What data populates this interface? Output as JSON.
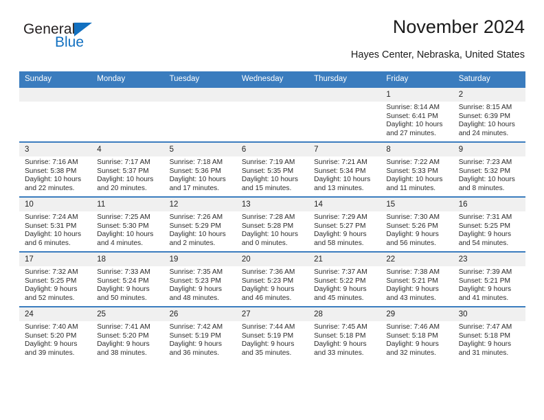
{
  "logo": {
    "word_top": "General",
    "word_bottom": "Blue",
    "triangle_icon": "triangle-icon",
    "brand_color": "#1270c0"
  },
  "header": {
    "title": "November 2024",
    "subtitle": "Hayes Center, Nebraska, United States"
  },
  "theme": {
    "header_blue": "#3a7cbe",
    "daynum_gray": "#f0f0f0"
  },
  "calendar": {
    "weekday_headers": [
      "Sunday",
      "Monday",
      "Tuesday",
      "Wednesday",
      "Thursday",
      "Friday",
      "Saturday"
    ],
    "labels": {
      "sunrise": "Sunrise:",
      "sunset": "Sunset:",
      "daylight": "Daylight:"
    },
    "weeks": [
      [
        {
          "day": "",
          "empty": true
        },
        {
          "day": "",
          "empty": true
        },
        {
          "day": "",
          "empty": true
        },
        {
          "day": "",
          "empty": true
        },
        {
          "day": "",
          "empty": true
        },
        {
          "day": "1",
          "sunrise": "Sunrise: 8:14 AM",
          "sunset": "Sunset: 6:41 PM",
          "daylight": "Daylight: 10 hours and 27 minutes."
        },
        {
          "day": "2",
          "sunrise": "Sunrise: 8:15 AM",
          "sunset": "Sunset: 6:39 PM",
          "daylight": "Daylight: 10 hours and 24 minutes."
        }
      ],
      [
        {
          "day": "3",
          "sunrise": "Sunrise: 7:16 AM",
          "sunset": "Sunset: 5:38 PM",
          "daylight": "Daylight: 10 hours and 22 minutes."
        },
        {
          "day": "4",
          "sunrise": "Sunrise: 7:17 AM",
          "sunset": "Sunset: 5:37 PM",
          "daylight": "Daylight: 10 hours and 20 minutes."
        },
        {
          "day": "5",
          "sunrise": "Sunrise: 7:18 AM",
          "sunset": "Sunset: 5:36 PM",
          "daylight": "Daylight: 10 hours and 17 minutes."
        },
        {
          "day": "6",
          "sunrise": "Sunrise: 7:19 AM",
          "sunset": "Sunset: 5:35 PM",
          "daylight": "Daylight: 10 hours and 15 minutes."
        },
        {
          "day": "7",
          "sunrise": "Sunrise: 7:21 AM",
          "sunset": "Sunset: 5:34 PM",
          "daylight": "Daylight: 10 hours and 13 minutes."
        },
        {
          "day": "8",
          "sunrise": "Sunrise: 7:22 AM",
          "sunset": "Sunset: 5:33 PM",
          "daylight": "Daylight: 10 hours and 11 minutes."
        },
        {
          "day": "9",
          "sunrise": "Sunrise: 7:23 AM",
          "sunset": "Sunset: 5:32 PM",
          "daylight": "Daylight: 10 hours and 8 minutes."
        }
      ],
      [
        {
          "day": "10",
          "sunrise": "Sunrise: 7:24 AM",
          "sunset": "Sunset: 5:31 PM",
          "daylight": "Daylight: 10 hours and 6 minutes."
        },
        {
          "day": "11",
          "sunrise": "Sunrise: 7:25 AM",
          "sunset": "Sunset: 5:30 PM",
          "daylight": "Daylight: 10 hours and 4 minutes."
        },
        {
          "day": "12",
          "sunrise": "Sunrise: 7:26 AM",
          "sunset": "Sunset: 5:29 PM",
          "daylight": "Daylight: 10 hours and 2 minutes."
        },
        {
          "day": "13",
          "sunrise": "Sunrise: 7:28 AM",
          "sunset": "Sunset: 5:28 PM",
          "daylight": "Daylight: 10 hours and 0 minutes."
        },
        {
          "day": "14",
          "sunrise": "Sunrise: 7:29 AM",
          "sunset": "Sunset: 5:27 PM",
          "daylight": "Daylight: 9 hours and 58 minutes."
        },
        {
          "day": "15",
          "sunrise": "Sunrise: 7:30 AM",
          "sunset": "Sunset: 5:26 PM",
          "daylight": "Daylight: 9 hours and 56 minutes."
        },
        {
          "day": "16",
          "sunrise": "Sunrise: 7:31 AM",
          "sunset": "Sunset: 5:25 PM",
          "daylight": "Daylight: 9 hours and 54 minutes."
        }
      ],
      [
        {
          "day": "17",
          "sunrise": "Sunrise: 7:32 AM",
          "sunset": "Sunset: 5:25 PM",
          "daylight": "Daylight: 9 hours and 52 minutes."
        },
        {
          "day": "18",
          "sunrise": "Sunrise: 7:33 AM",
          "sunset": "Sunset: 5:24 PM",
          "daylight": "Daylight: 9 hours and 50 minutes."
        },
        {
          "day": "19",
          "sunrise": "Sunrise: 7:35 AM",
          "sunset": "Sunset: 5:23 PM",
          "daylight": "Daylight: 9 hours and 48 minutes."
        },
        {
          "day": "20",
          "sunrise": "Sunrise: 7:36 AM",
          "sunset": "Sunset: 5:23 PM",
          "daylight": "Daylight: 9 hours and 46 minutes."
        },
        {
          "day": "21",
          "sunrise": "Sunrise: 7:37 AM",
          "sunset": "Sunset: 5:22 PM",
          "daylight": "Daylight: 9 hours and 45 minutes."
        },
        {
          "day": "22",
          "sunrise": "Sunrise: 7:38 AM",
          "sunset": "Sunset: 5:21 PM",
          "daylight": "Daylight: 9 hours and 43 minutes."
        },
        {
          "day": "23",
          "sunrise": "Sunrise: 7:39 AM",
          "sunset": "Sunset: 5:21 PM",
          "daylight": "Daylight: 9 hours and 41 minutes."
        }
      ],
      [
        {
          "day": "24",
          "sunrise": "Sunrise: 7:40 AM",
          "sunset": "Sunset: 5:20 PM",
          "daylight": "Daylight: 9 hours and 39 minutes."
        },
        {
          "day": "25",
          "sunrise": "Sunrise: 7:41 AM",
          "sunset": "Sunset: 5:20 PM",
          "daylight": "Daylight: 9 hours and 38 minutes."
        },
        {
          "day": "26",
          "sunrise": "Sunrise: 7:42 AM",
          "sunset": "Sunset: 5:19 PM",
          "daylight": "Daylight: 9 hours and 36 minutes."
        },
        {
          "day": "27",
          "sunrise": "Sunrise: 7:44 AM",
          "sunset": "Sunset: 5:19 PM",
          "daylight": "Daylight: 9 hours and 35 minutes."
        },
        {
          "day": "28",
          "sunrise": "Sunrise: 7:45 AM",
          "sunset": "Sunset: 5:18 PM",
          "daylight": "Daylight: 9 hours and 33 minutes."
        },
        {
          "day": "29",
          "sunrise": "Sunrise: 7:46 AM",
          "sunset": "Sunset: 5:18 PM",
          "daylight": "Daylight: 9 hours and 32 minutes."
        },
        {
          "day": "30",
          "sunrise": "Sunrise: 7:47 AM",
          "sunset": "Sunset: 5:18 PM",
          "daylight": "Daylight: 9 hours and 31 minutes."
        }
      ]
    ]
  }
}
